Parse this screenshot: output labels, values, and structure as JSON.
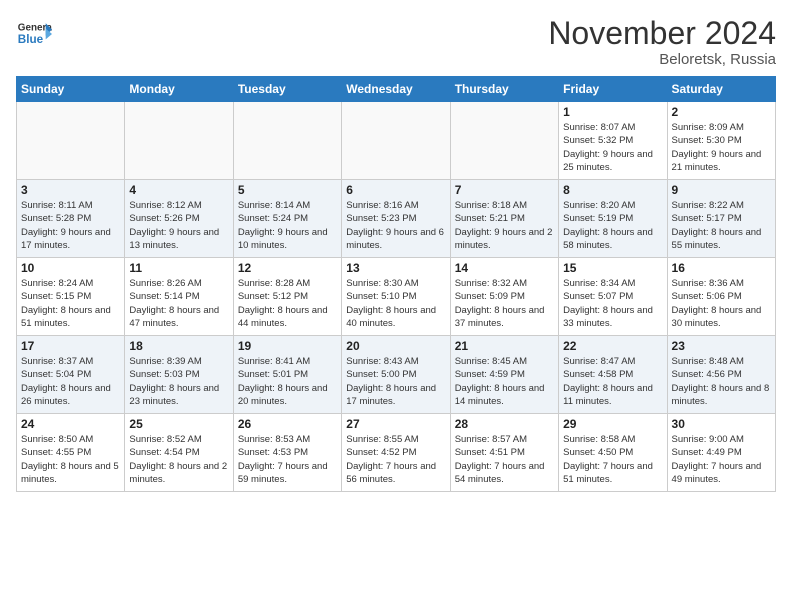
{
  "header": {
    "logo": {
      "general": "General",
      "blue": "Blue"
    },
    "title": "November 2024",
    "location": "Beloretsk, Russia"
  },
  "weekdays": [
    "Sunday",
    "Monday",
    "Tuesday",
    "Wednesday",
    "Thursday",
    "Friday",
    "Saturday"
  ],
  "weeks": [
    [
      {
        "day": "",
        "info": ""
      },
      {
        "day": "",
        "info": ""
      },
      {
        "day": "",
        "info": ""
      },
      {
        "day": "",
        "info": ""
      },
      {
        "day": "",
        "info": ""
      },
      {
        "day": "1",
        "info": "Sunrise: 8:07 AM\nSunset: 5:32 PM\nDaylight: 9 hours\nand 25 minutes."
      },
      {
        "day": "2",
        "info": "Sunrise: 8:09 AM\nSunset: 5:30 PM\nDaylight: 9 hours\nand 21 minutes."
      }
    ],
    [
      {
        "day": "3",
        "info": "Sunrise: 8:11 AM\nSunset: 5:28 PM\nDaylight: 9 hours\nand 17 minutes."
      },
      {
        "day": "4",
        "info": "Sunrise: 8:12 AM\nSunset: 5:26 PM\nDaylight: 9 hours\nand 13 minutes."
      },
      {
        "day": "5",
        "info": "Sunrise: 8:14 AM\nSunset: 5:24 PM\nDaylight: 9 hours\nand 10 minutes."
      },
      {
        "day": "6",
        "info": "Sunrise: 8:16 AM\nSunset: 5:23 PM\nDaylight: 9 hours\nand 6 minutes."
      },
      {
        "day": "7",
        "info": "Sunrise: 8:18 AM\nSunset: 5:21 PM\nDaylight: 9 hours\nand 2 minutes."
      },
      {
        "day": "8",
        "info": "Sunrise: 8:20 AM\nSunset: 5:19 PM\nDaylight: 8 hours\nand 58 minutes."
      },
      {
        "day": "9",
        "info": "Sunrise: 8:22 AM\nSunset: 5:17 PM\nDaylight: 8 hours\nand 55 minutes."
      }
    ],
    [
      {
        "day": "10",
        "info": "Sunrise: 8:24 AM\nSunset: 5:15 PM\nDaylight: 8 hours\nand 51 minutes."
      },
      {
        "day": "11",
        "info": "Sunrise: 8:26 AM\nSunset: 5:14 PM\nDaylight: 8 hours\nand 47 minutes."
      },
      {
        "day": "12",
        "info": "Sunrise: 8:28 AM\nSunset: 5:12 PM\nDaylight: 8 hours\nand 44 minutes."
      },
      {
        "day": "13",
        "info": "Sunrise: 8:30 AM\nSunset: 5:10 PM\nDaylight: 8 hours\nand 40 minutes."
      },
      {
        "day": "14",
        "info": "Sunrise: 8:32 AM\nSunset: 5:09 PM\nDaylight: 8 hours\nand 37 minutes."
      },
      {
        "day": "15",
        "info": "Sunrise: 8:34 AM\nSunset: 5:07 PM\nDaylight: 8 hours\nand 33 minutes."
      },
      {
        "day": "16",
        "info": "Sunrise: 8:36 AM\nSunset: 5:06 PM\nDaylight: 8 hours\nand 30 minutes."
      }
    ],
    [
      {
        "day": "17",
        "info": "Sunrise: 8:37 AM\nSunset: 5:04 PM\nDaylight: 8 hours\nand 26 minutes."
      },
      {
        "day": "18",
        "info": "Sunrise: 8:39 AM\nSunset: 5:03 PM\nDaylight: 8 hours\nand 23 minutes."
      },
      {
        "day": "19",
        "info": "Sunrise: 8:41 AM\nSunset: 5:01 PM\nDaylight: 8 hours\nand 20 minutes."
      },
      {
        "day": "20",
        "info": "Sunrise: 8:43 AM\nSunset: 5:00 PM\nDaylight: 8 hours\nand 17 minutes."
      },
      {
        "day": "21",
        "info": "Sunrise: 8:45 AM\nSunset: 4:59 PM\nDaylight: 8 hours\nand 14 minutes."
      },
      {
        "day": "22",
        "info": "Sunrise: 8:47 AM\nSunset: 4:58 PM\nDaylight: 8 hours\nand 11 minutes."
      },
      {
        "day": "23",
        "info": "Sunrise: 8:48 AM\nSunset: 4:56 PM\nDaylight: 8 hours\nand 8 minutes."
      }
    ],
    [
      {
        "day": "24",
        "info": "Sunrise: 8:50 AM\nSunset: 4:55 PM\nDaylight: 8 hours\nand 5 minutes."
      },
      {
        "day": "25",
        "info": "Sunrise: 8:52 AM\nSunset: 4:54 PM\nDaylight: 8 hours\nand 2 minutes."
      },
      {
        "day": "26",
        "info": "Sunrise: 8:53 AM\nSunset: 4:53 PM\nDaylight: 7 hours\nand 59 minutes."
      },
      {
        "day": "27",
        "info": "Sunrise: 8:55 AM\nSunset: 4:52 PM\nDaylight: 7 hours\nand 56 minutes."
      },
      {
        "day": "28",
        "info": "Sunrise: 8:57 AM\nSunset: 4:51 PM\nDaylight: 7 hours\nand 54 minutes."
      },
      {
        "day": "29",
        "info": "Sunrise: 8:58 AM\nSunset: 4:50 PM\nDaylight: 7 hours\nand 51 minutes."
      },
      {
        "day": "30",
        "info": "Sunrise: 9:00 AM\nSunset: 4:49 PM\nDaylight: 7 hours\nand 49 minutes."
      }
    ]
  ]
}
